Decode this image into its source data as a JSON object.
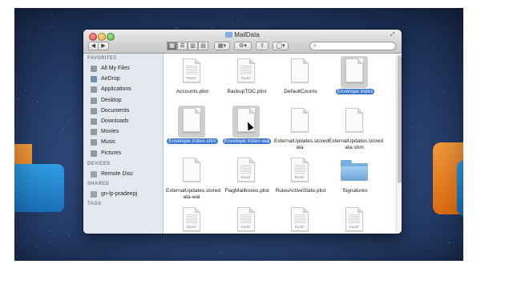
{
  "window": {
    "title": "MailData"
  },
  "toolbar": {
    "back_glyph": "◀",
    "forward_glyph": "▶",
    "views": [
      "▦",
      "☰",
      "▥",
      "▤"
    ],
    "arrange_glyph": "▦▾",
    "action_glyph": "⚙▾",
    "share_glyph": "⇪",
    "label_glyph": "◯▾",
    "fullscreen_glyph": "⤢",
    "search_placeholder": "",
    "search_glyph": "⌕"
  },
  "sidebar": {
    "favorites_head": "FAVORITES",
    "favorites": [
      {
        "label": "All My Files",
        "icon": "all-files-icon",
        "color": "#8e9aa8"
      },
      {
        "label": "AirDrop",
        "icon": "airdrop-icon",
        "color": "#6f8fb5"
      },
      {
        "label": "Applications",
        "icon": "applications-icon",
        "color": "#8e9aa8"
      },
      {
        "label": "Desktop",
        "icon": "desktop-icon",
        "color": "#8e9aa8"
      },
      {
        "label": "Documents",
        "icon": "documents-icon",
        "color": "#8e9aa8"
      },
      {
        "label": "Downloads",
        "icon": "downloads-icon",
        "color": "#8e9aa8"
      },
      {
        "label": "Movies",
        "icon": "movies-icon",
        "color": "#8e9aa8"
      },
      {
        "label": "Music",
        "icon": "music-icon",
        "color": "#8e9aa8"
      },
      {
        "label": "Pictures",
        "icon": "pictures-icon",
        "color": "#8e9aa8"
      }
    ],
    "devices_head": "DEVICES",
    "devices": [
      {
        "label": "Remote Disc",
        "icon": "remote-disc-icon",
        "color": "#9aa3ad"
      }
    ],
    "shared_head": "SHARED",
    "shared": [
      {
        "label": "gn-lp-pradeepj",
        "icon": "network-computer-icon",
        "color": "#9aa3ad"
      }
    ],
    "tags_head": "TAGS"
  },
  "files": [
    {
      "name": "Accounts.plist",
      "kind": "plist",
      "tag": "PLIST",
      "selected": false
    },
    {
      "name": "BackupTOC.plist",
      "kind": "plist",
      "tag": "PLIST",
      "selected": false
    },
    {
      "name": "DefaultCounts",
      "kind": "doc",
      "tag": "",
      "selected": false
    },
    {
      "name": "Envelope Index",
      "kind": "doc",
      "tag": "",
      "selected": true
    },
    {
      "name": "Envelope Index-shm",
      "kind": "doc",
      "tag": "",
      "selected": true
    },
    {
      "name": "Envelope Index-wal",
      "kind": "doc",
      "tag": "",
      "selected": true
    },
    {
      "name": "ExternalUpdates.storedata",
      "kind": "doc",
      "tag": "",
      "selected": false
    },
    {
      "name": "ExternalUpdates.storedata-shm",
      "kind": "doc",
      "tag": "",
      "selected": false
    },
    {
      "name": "ExternalUpdates.storedata-wal",
      "kind": "doc",
      "tag": "",
      "selected": false
    },
    {
      "name": "FlagMailboxes.plist",
      "kind": "plist",
      "tag": "PLIST",
      "selected": false
    },
    {
      "name": "RulesActiveState.plist",
      "kind": "plist",
      "tag": "PLIST",
      "selected": false
    },
    {
      "name": "Signatures",
      "kind": "folder",
      "tag": "",
      "selected": false
    },
    {
      "name": "",
      "kind": "plist",
      "tag": "PLIST",
      "selected": false
    },
    {
      "name": "",
      "kind": "plist",
      "tag": "PLIST",
      "selected": false
    },
    {
      "name": "",
      "kind": "plist",
      "tag": "PLIST",
      "selected": false
    },
    {
      "name": "",
      "kind": "plist",
      "tag": "PLIST",
      "selected": false
    }
  ],
  "colors": {
    "selection": "#3875d7",
    "sidebar_bg": "#e4e9ef",
    "folder": "#7aaedf"
  }
}
